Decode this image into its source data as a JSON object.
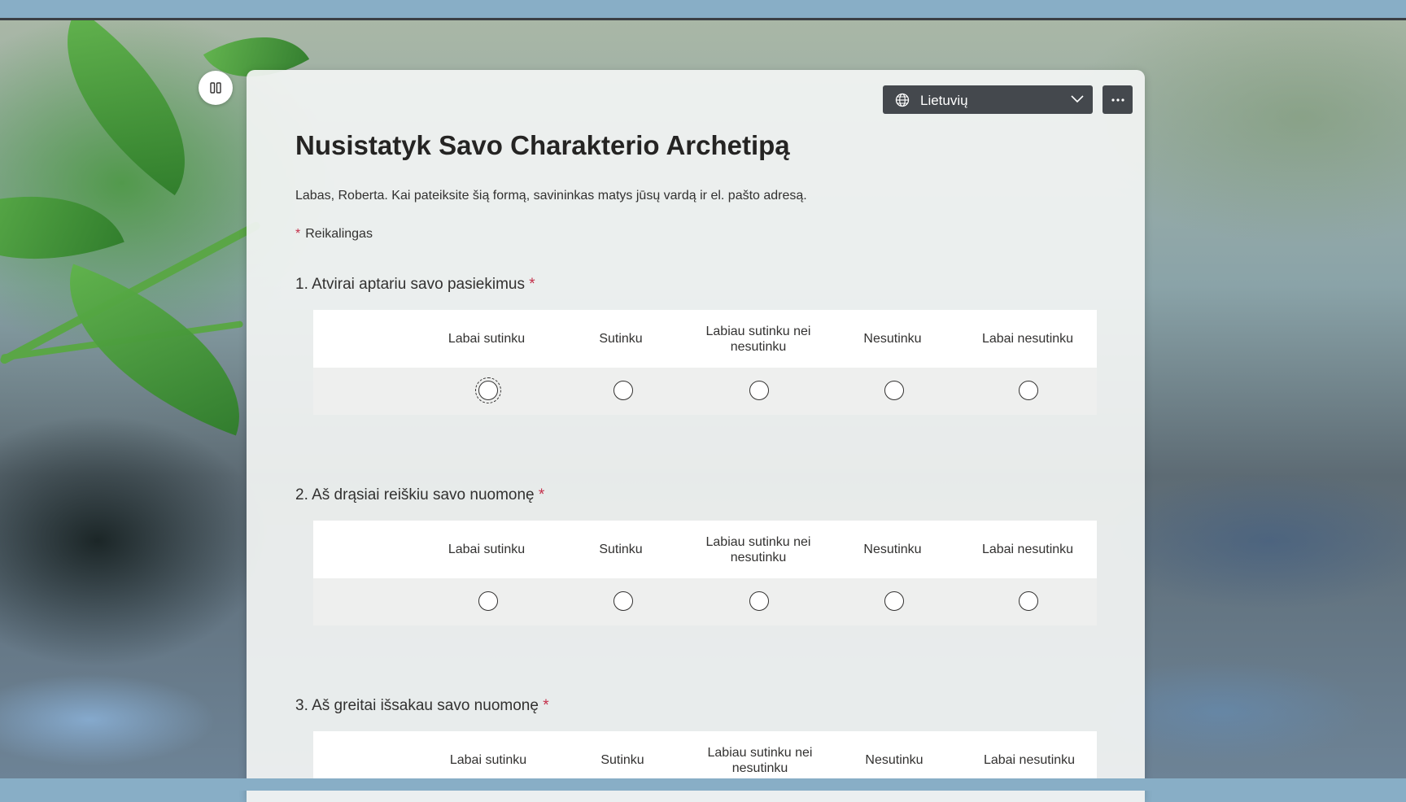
{
  "language_selector": {
    "value": "Lietuvių",
    "icon": "globe-icon"
  },
  "more_menu": {
    "label": "···"
  },
  "form": {
    "title": "Nusistatyk Savo Charakterio Archetipą",
    "greeting": "Labas, Roberta. Kai pateiksite šią formą, savininkas matys jūsų vardą ir el. pašto adresą.",
    "required_star": "*",
    "required_label": "Reikalingas"
  },
  "scale_options": [
    "Labai sutinku",
    "Sutinku",
    "Labiau sutinku nei nesutinku",
    "Nesutinku",
    "Labai nesutinku"
  ],
  "questions": [
    {
      "number": "1.",
      "text": "Atvirai aptariu savo pasiekimus",
      "required": "*"
    },
    {
      "number": "2.",
      "text": "Aš drąsiai reiškiu savo nuomonę",
      "required": "*"
    },
    {
      "number": "3.",
      "text": "Aš greitai išsakau savo nuomonę",
      "required": "*"
    }
  ]
}
